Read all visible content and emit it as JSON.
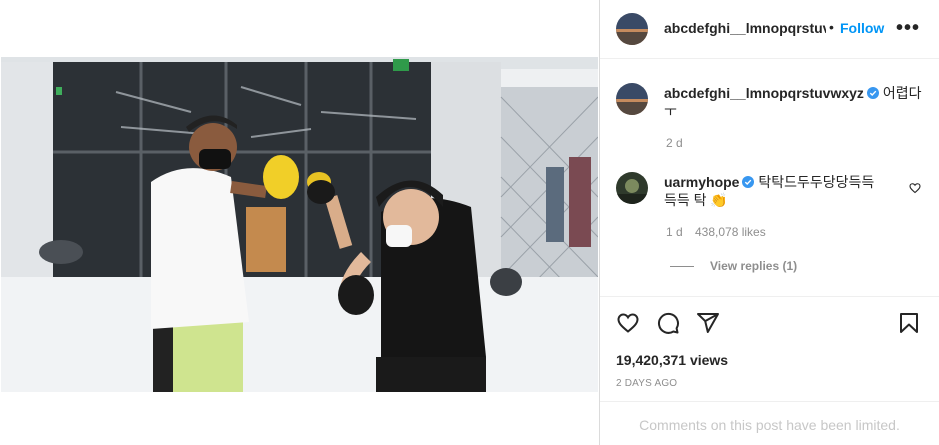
{
  "post": {
    "author": "abcdefghi__lmnopqrstuvwxyz",
    "header_author_display": "abcdefghi__lmnopqrstuvv",
    "follow_label": "Follow",
    "header_dot": "•",
    "more_label": "•••"
  },
  "caption": {
    "author": "abcdefghi__lmnopqrstuvwxyz",
    "text_line1": "어렵다",
    "text_line2": "ㅜ",
    "age": "2 d"
  },
  "comment": {
    "author": "uarmyhope",
    "text_line1": "탁탁드두두당당득득",
    "text_line2": "득득 탁 👏",
    "age": "1 d",
    "likes": "438,078 likes",
    "view_replies": "View replies (1)"
  },
  "stats": {
    "views": "19,420,371 views",
    "date": "2 DAYS AGO"
  },
  "footer": {
    "limited": "Comments on this post have been limited."
  },
  "icons": {
    "like": "heart-icon",
    "comment": "comment-icon",
    "share": "share-icon",
    "save": "bookmark-icon",
    "verified": "verified-badge-icon"
  },
  "colors": {
    "link_blue": "#0095f6",
    "verified_blue": "#3897f0",
    "muted": "#8e8e8e",
    "text": "#262626"
  }
}
